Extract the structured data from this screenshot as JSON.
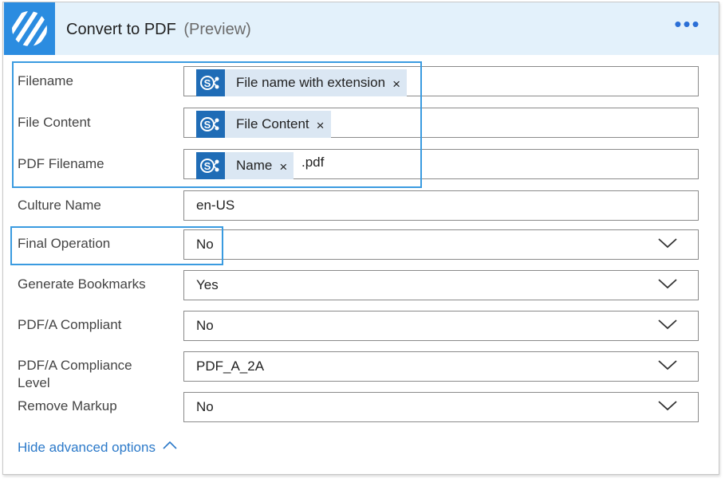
{
  "header": {
    "title": "Convert to PDF",
    "preview": "(Preview)",
    "more": "•••"
  },
  "fields": {
    "filename": {
      "label": "Filename",
      "token": "File name with extension"
    },
    "file_content": {
      "label": "File Content",
      "token": "File Content"
    },
    "pdf_filename": {
      "label": "PDF Filename",
      "token": "Name",
      "suffix": ".pdf"
    },
    "culture_name": {
      "label": "Culture Name",
      "value": "en-US"
    },
    "final_operation": {
      "label": "Final Operation",
      "value": "No"
    },
    "generate_bookmarks": {
      "label": "Generate Bookmarks",
      "value": "Yes"
    },
    "pdfa_compliant": {
      "label": "PDF/A Compliant",
      "value": "No"
    },
    "pdfa_compliance_level": {
      "label_line1": "PDF/A Compliance",
      "label_line2": "Level",
      "value": "PDF_A_2A"
    },
    "remove_markup": {
      "label": "Remove Markup",
      "value": "No"
    }
  },
  "token_remove": "×",
  "footer": {
    "hide_advanced": "Hide advanced options"
  },
  "colors": {
    "accent": "#2b8ce0",
    "header_bg": "#e3f1fb",
    "token_bg": "#dbe7f3",
    "sharepoint": "#1f6cb6",
    "highlight": "#3a9be0",
    "link": "#2b79c9"
  }
}
